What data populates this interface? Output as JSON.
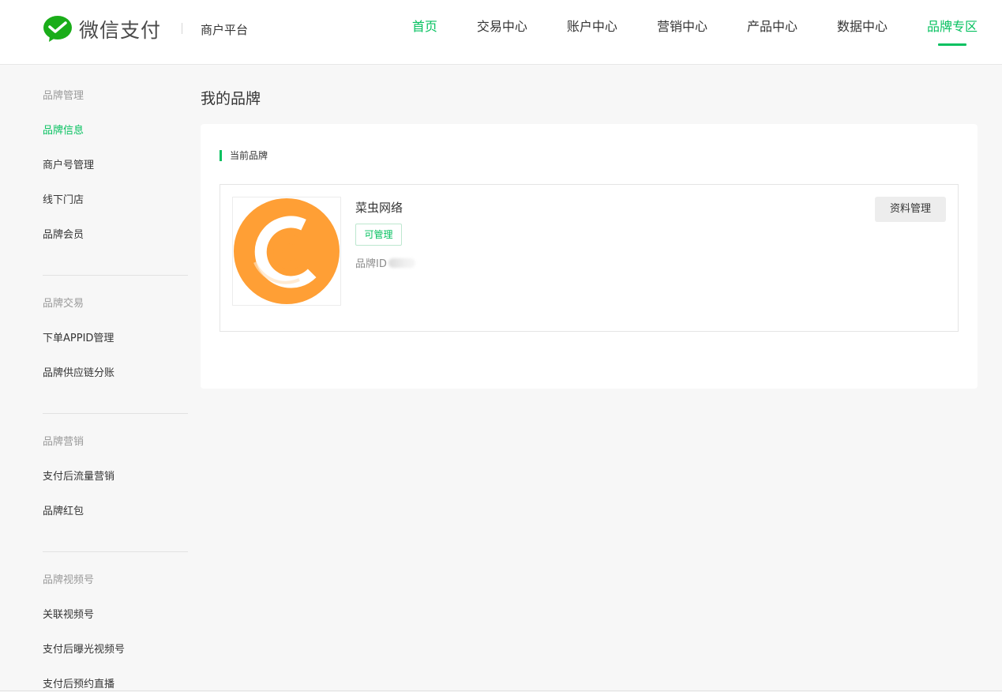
{
  "header": {
    "logo_text": "微信支付",
    "platform_name": "商户平台",
    "nav": [
      {
        "label": "首页"
      },
      {
        "label": "交易中心"
      },
      {
        "label": "账户中心"
      },
      {
        "label": "营销中心"
      },
      {
        "label": "产品中心"
      },
      {
        "label": "数据中心"
      },
      {
        "label": "品牌专区"
      }
    ]
  },
  "sidebar": {
    "groups": [
      {
        "title": "品牌管理",
        "items": [
          {
            "label": "品牌信息"
          },
          {
            "label": "商户号管理"
          },
          {
            "label": "线下门店"
          },
          {
            "label": "品牌会员"
          }
        ]
      },
      {
        "title": "品牌交易",
        "items": [
          {
            "label": "下单APPID管理"
          },
          {
            "label": "品牌供应链分账"
          }
        ]
      },
      {
        "title": "品牌营销",
        "items": [
          {
            "label": "支付后流量营销"
          },
          {
            "label": "品牌红包"
          }
        ]
      },
      {
        "title": "品牌视频号",
        "items": [
          {
            "label": "关联视频号"
          },
          {
            "label": "支付后曝光视频号"
          },
          {
            "label": "支付后预约直播"
          }
        ]
      }
    ]
  },
  "main": {
    "page_title": "我的品牌",
    "section_label": "当前品牌",
    "brand": {
      "name": "菜虫网络",
      "badge": "可管理",
      "id_label": "品牌ID",
      "manage_button": "资料管理"
    }
  },
  "colors": {
    "accent_green": "#07c160",
    "brand_logo_orange": "#ff9f35"
  },
  "icons": {
    "logo": "wechat-pay-logo-icon",
    "brand_logo": "brand-c-logo"
  }
}
